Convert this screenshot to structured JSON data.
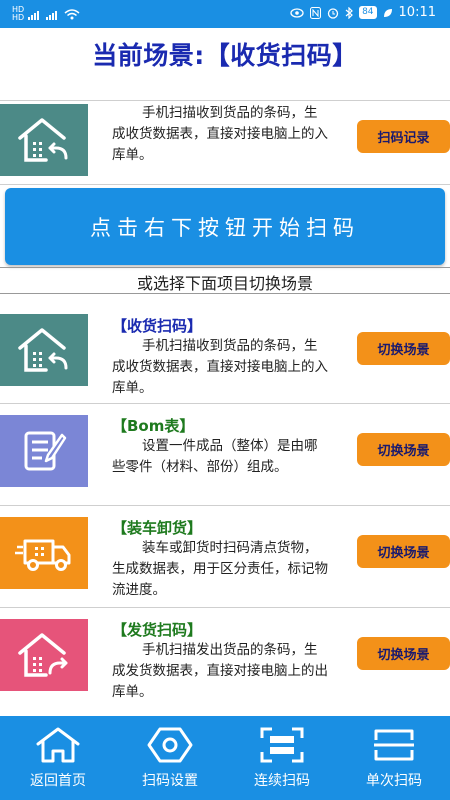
{
  "status_bar": {
    "left": "HD 4G 4G",
    "battery": "84",
    "time": "10:11"
  },
  "page_title": "当前场景:【收货扫码】",
  "current": {
    "description": "手机扫描收到货品的条码，生成收货数据表，直接对接电脑上的入库单。",
    "button_label": "扫码记录",
    "tile_color": "#4c8a87",
    "icon": "house-receive-icon"
  },
  "main_button_label": "点击右下按钮开始扫码",
  "switch_hint": "或选择下面项目切换场景",
  "scenes": [
    {
      "title": "【收货扫码】",
      "description": "手机扫描收到货品的条码，生成收货数据表，直接对接电脑上的入库单。",
      "button_label": "切换场景",
      "tile_color": "#4c8a87",
      "title_color": "#1a2ab0",
      "icon": "house-receive-icon"
    },
    {
      "title": "【Bom表】",
      "description": "设置一件成品（整体）是由哪些零件（材料、部份）组成。",
      "button_label": "切换场景",
      "tile_color": "#7b86d6",
      "title_color": "#1e7a1e",
      "icon": "document-edit-icon"
    },
    {
      "title": "【装车卸货】",
      "description": "装车或卸货时扫码清点货物，生成数据表，用于区分责任，标记物流进度。",
      "button_label": "切换场景",
      "tile_color": "#f39119",
      "title_color": "#1e7a1e",
      "icon": "truck-icon"
    },
    {
      "title": "【发货扫码】",
      "description": "手机扫描发出货品的条码，生成发货数据表，直接对接电脑上的出库单。",
      "button_label": "切换场景",
      "tile_color": "#e6547a",
      "title_color": "#1e7a1e",
      "icon": "house-send-icon"
    }
  ],
  "bottom_nav": [
    {
      "label": "返回首页",
      "icon": "home-icon"
    },
    {
      "label": "扫码设置",
      "icon": "settings-hex-icon"
    },
    {
      "label": "连续扫码",
      "icon": "continuous-scan-icon"
    },
    {
      "label": "单次扫码",
      "icon": "single-scan-icon"
    }
  ]
}
